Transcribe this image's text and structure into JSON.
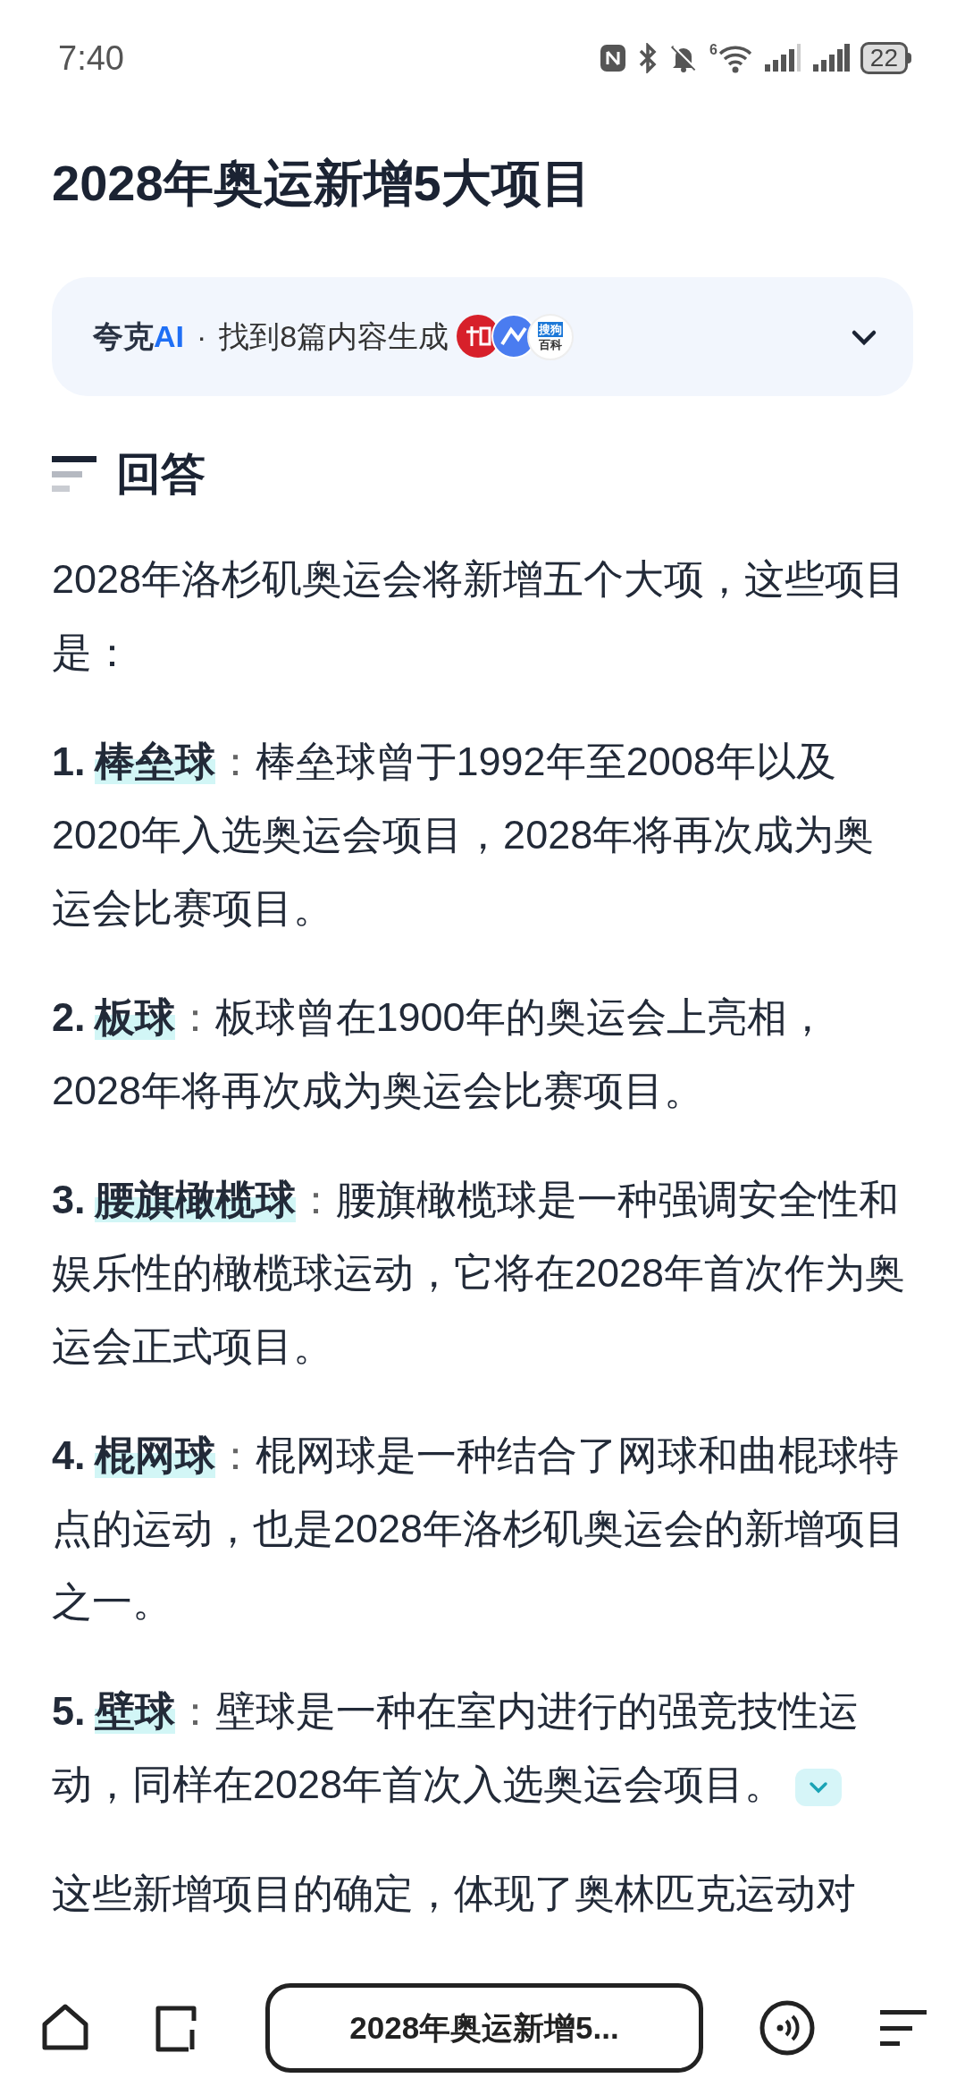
{
  "status_bar": {
    "time": "7:40",
    "wifi_generation": "6",
    "battery": "22"
  },
  "title": "2028年奥运新增5大项目",
  "source_card": {
    "brand": "夸克",
    "brand_ai": "AI",
    "separator": "·",
    "summary": "找到8篇内容生成",
    "expanded": false,
    "sources": [
      {
        "kind": "red-badge"
      },
      {
        "kind": "blue-badge"
      },
      {
        "kind": "text-badge",
        "lines": [
          "搜狗",
          "百科"
        ]
      }
    ]
  },
  "answer": {
    "heading": "回答",
    "intro": "2028年洛杉矶奥运会将新增五个大项，这些项目是：",
    "items": [
      {
        "number": "1.",
        "term": "棒垒球",
        "colon": "：",
        "text": "棒垒球曾于1992年至2008年以及2020年入选奥运会项目，2028年将再次成为奥运会比赛项目。",
        "source_toggle": false
      },
      {
        "number": "2.",
        "term": "板球",
        "colon": "：",
        "text": "板球曾在1900年的奥运会上亮相，2028年将再次成为奥运会比赛项目。",
        "source_toggle": false
      },
      {
        "number": "3.",
        "term": "腰旗橄榄球",
        "colon": "：",
        "text": "腰旗橄榄球是一种强调安全性和娱乐性的橄榄球运动，它将在2028年首次作为奥运会正式项目。",
        "source_toggle": false
      },
      {
        "number": "4.",
        "term": "棍网球",
        "colon": "：",
        "text": "棍网球是一种结合了网球和曲棍球特点的运动，也是2028年洛杉矶奥运会的新增项目之一。",
        "source_toggle": false
      },
      {
        "number": "5.",
        "term": "壁球",
        "colon": "：",
        "text": "壁球是一种在室内进行的强竞技性运动，同样在2028年首次入选奥运会项目。",
        "source_toggle": true
      }
    ],
    "conclusion": "这些新增项目的确定，体现了奥林匹克运动对"
  },
  "bottom_bar": {
    "tab_title": "2028年奥运新增5..."
  }
}
